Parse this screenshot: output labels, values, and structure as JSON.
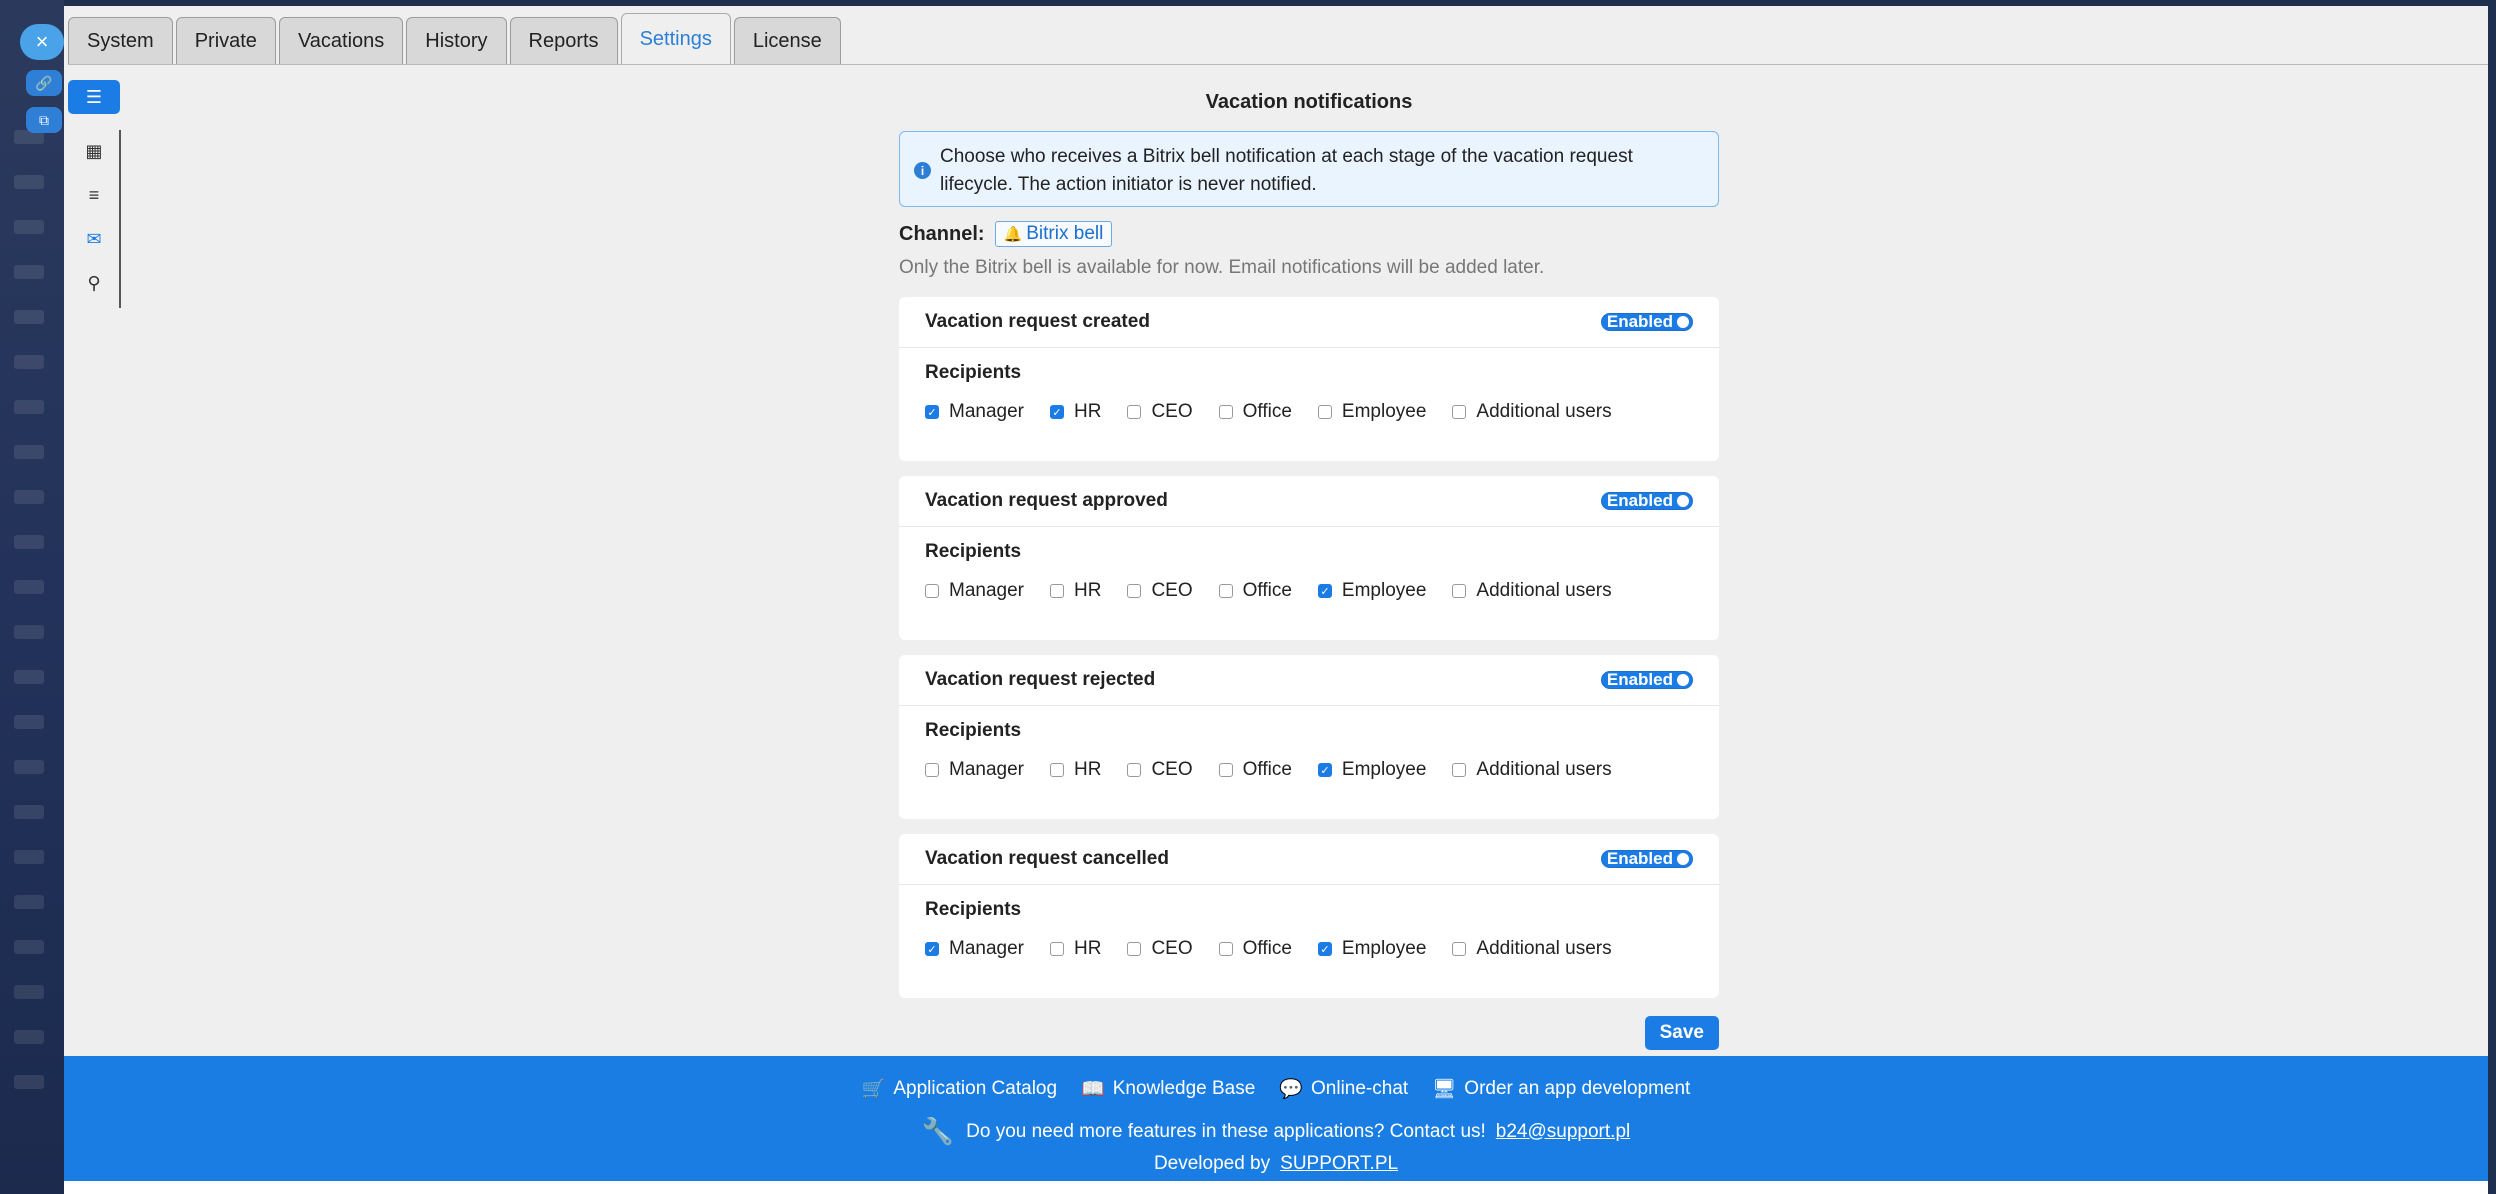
{
  "tabs": [
    {
      "label": "System"
    },
    {
      "label": "Private"
    },
    {
      "label": "Vacations"
    },
    {
      "label": "History"
    },
    {
      "label": "Reports"
    },
    {
      "label": "Settings",
      "active": true
    },
    {
      "label": "License"
    }
  ],
  "page": {
    "title": "Vacation notifications",
    "info": "Choose who receives a Bitrix bell notification at each stage of the vacation request lifecycle. The action initiator is never notified.",
    "channel_label": "Channel:",
    "channel_value": "Bitrix bell",
    "note": "Only the Bitrix bell is available for now. Email notifications will be added later."
  },
  "recipient_options": [
    "Manager",
    "HR",
    "CEO",
    "Office",
    "Employee",
    "Additional users"
  ],
  "cards": [
    {
      "title": "Vacation request created",
      "status": "Enabled",
      "recipients_label": "Recipients",
      "checked": [
        true,
        true,
        false,
        false,
        false,
        false
      ]
    },
    {
      "title": "Vacation request approved",
      "status": "Enabled",
      "recipients_label": "Recipients",
      "checked": [
        false,
        false,
        false,
        false,
        true,
        false
      ]
    },
    {
      "title": "Vacation request rejected",
      "status": "Enabled",
      "recipients_label": "Recipients",
      "checked": [
        false,
        false,
        false,
        false,
        true,
        false
      ]
    },
    {
      "title": "Vacation request cancelled",
      "status": "Enabled",
      "recipients_label": "Recipients",
      "checked": [
        true,
        false,
        false,
        false,
        true,
        false
      ]
    }
  ],
  "save_label": "Save",
  "footer": {
    "links": [
      {
        "label": "Application Catalog",
        "icon": "cart-icon"
      },
      {
        "label": "Knowledge Base",
        "icon": "book-icon"
      },
      {
        "label": "Online-chat",
        "icon": "chat-icon"
      },
      {
        "label": "Order an app development",
        "icon": "monitor-icon"
      }
    ],
    "ask_text": "Do you need more features in these applications? Contact us!",
    "email": "b24@support.pl",
    "dev_text": "Developed by",
    "dev_link": "SUPPORT.PL"
  },
  "colors": {
    "accent": "#1c7ce5",
    "footer": "#1a7de3",
    "info_bg": "#e9f4ff"
  }
}
